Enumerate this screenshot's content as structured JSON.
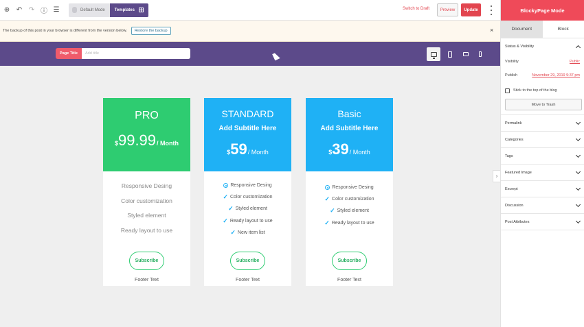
{
  "toolbar": {
    "default_mode": "Default Mode",
    "templates": "Templates",
    "switch_to_draft": "Switch to Draft",
    "preview": "Preview",
    "update": "Update"
  },
  "notice": {
    "text": "The backup of this post in your browser is different from the version below.",
    "restore": "Restore the backup",
    "close": "×"
  },
  "title_bar": {
    "badge": "Page Title",
    "placeholder": "Add title"
  },
  "pricing": {
    "cards": [
      {
        "title": "PRO",
        "currency": "$",
        "amount": "99.99",
        "period": "/ Month",
        "features": [
          "Responsive Desing",
          "Color customization",
          "Styled element",
          "Ready layout to use"
        ],
        "button": "Subscribe",
        "footer": "Footer Text"
      },
      {
        "title": "STANDARD",
        "subtitle": "Add Subtitle Here",
        "currency": "$",
        "amount": "59",
        "period": "/ Month",
        "features": [
          "Responsive Desing",
          "Color customization",
          "Styled element",
          "Ready layout to use",
          "New item list"
        ],
        "button": "Subscribe",
        "footer": "Footer Text"
      },
      {
        "title": "Basic",
        "subtitle": "Add Subtitle Here",
        "currency": "$",
        "amount": "39",
        "period": "/ Month",
        "features": [
          "Responsive Desing",
          "Color customization",
          "Styled element",
          "Ready layout to use"
        ],
        "button": "Subscribe",
        "footer": "Footer Text"
      }
    ]
  },
  "panel": {
    "title": "BlockyPage Mode",
    "tab_document": "Document",
    "tab_block": "Block",
    "status_visibility": "Status & Visibility",
    "visibility_label": "Visibility",
    "visibility_value": "Public",
    "publish_label": "Publish",
    "publish_value": "November 29, 2019 9:37 pm",
    "stick_label": "Stick to the top of the blog",
    "move_to_trash": "Move to Trash",
    "sections": [
      "Permalink",
      "Categories",
      "Tags",
      "Featured Image",
      "Excerpt",
      "Discussion",
      "Post Attributes"
    ]
  },
  "colors": {
    "purple": "#5c4a8a",
    "accent_red": "#ef4a59",
    "pro_green": "#2ecc71",
    "plan_blue": "#1fb1f5"
  }
}
